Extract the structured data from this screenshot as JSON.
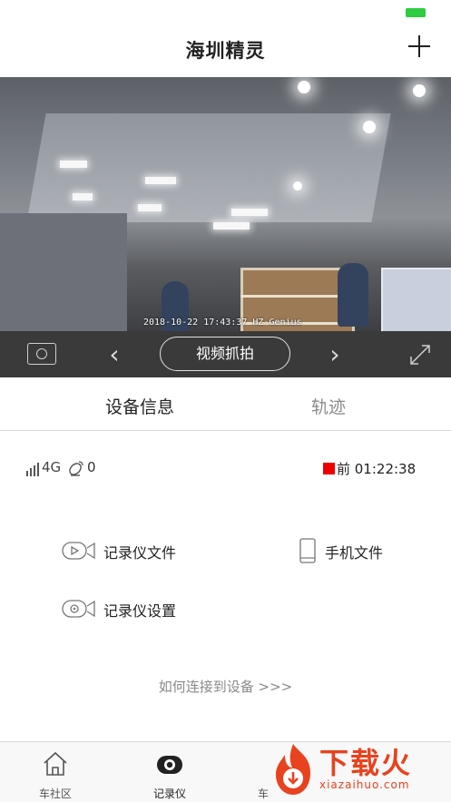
{
  "app": {
    "title": "海圳精灵"
  },
  "video": {
    "osd": "2018-10-22 17:43:37 HZ-Genius"
  },
  "controls": {
    "snapshot_label": "视频抓拍"
  },
  "tabs": [
    {
      "label": "设备信息",
      "active": true
    },
    {
      "label": "轨迹",
      "active": false
    }
  ],
  "status": {
    "network": "4G",
    "satellites": "0",
    "record_time": "前 01:22:38",
    "record_color": "#ee0000"
  },
  "functions": {
    "recorder_files": "记录仪文件",
    "phone_files": "手机文件",
    "recorder_settings": "记录仪设置"
  },
  "help": {
    "link_text": "如何连接到设备 >>>"
  },
  "tabbar": {
    "items": [
      {
        "label": "车社区",
        "icon": "home-icon",
        "active": false
      },
      {
        "label": "记录仪",
        "icon": "recorder-icon",
        "active": true
      },
      {
        "label": "车",
        "icon": "car-icon",
        "active": false
      }
    ]
  },
  "watermark": {
    "text": "下载火",
    "url": "xiazaihuo.com"
  },
  "colors": {
    "accent": "#e8421f",
    "battery": "#2ecc40"
  }
}
